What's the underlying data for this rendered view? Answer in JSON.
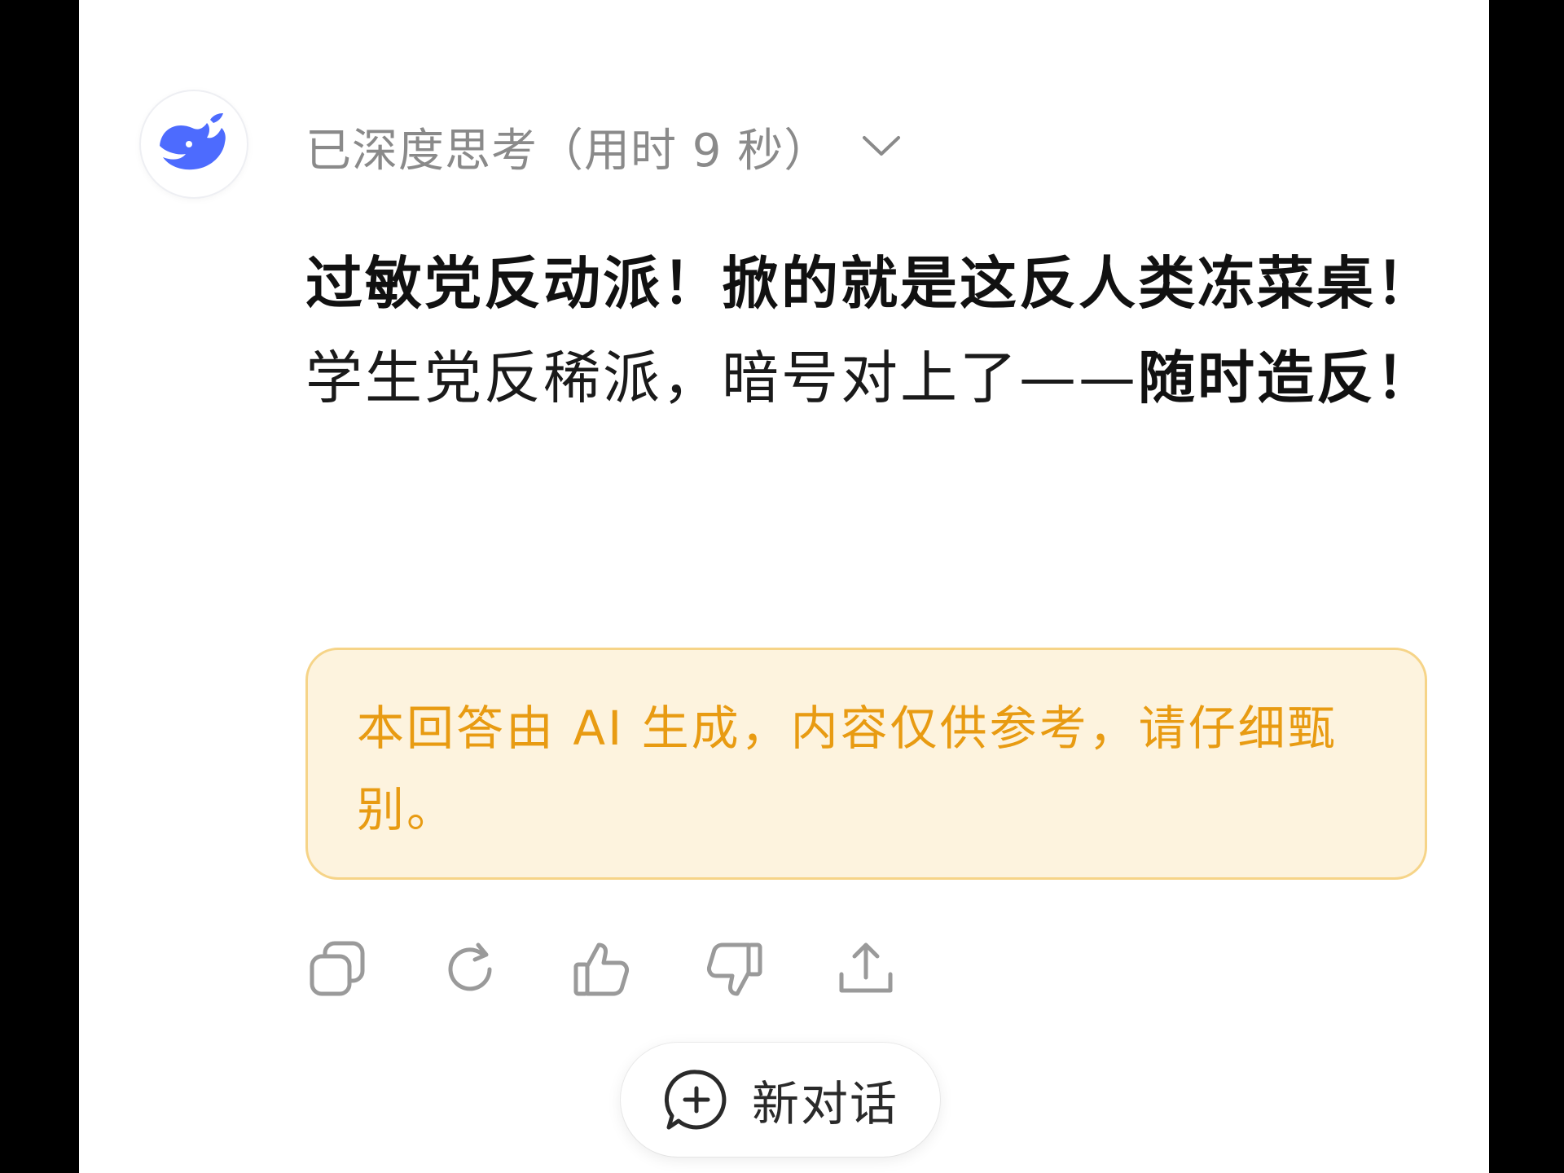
{
  "thinking": {
    "label": "已深度思考（用时 9 秒）"
  },
  "answer": {
    "line1": "过敏党反动派！掀的就是这反人类冻菜桌！",
    "line2_regular": "学生党反稀派，暗号对上了——",
    "line2_bold": "随时造反！"
  },
  "disclaimer": {
    "text": "本回答由 AI 生成，内容仅供参考，请仔细甄别。"
  },
  "actions": [
    {
      "icon": "copy-icon"
    },
    {
      "icon": "regenerate-icon"
    },
    {
      "icon": "thumbs-up-icon"
    },
    {
      "icon": "thumbs-down-icon"
    },
    {
      "icon": "share-icon"
    }
  ],
  "new_chat": {
    "label": "新对话"
  },
  "colors": {
    "brand_blue": "#4d6bfe",
    "disclaimer_text": "#e89b12",
    "disclaimer_bg": "#fdf3de",
    "disclaimer_border": "#f6d488",
    "muted_text": "#8a8a8a",
    "icon_gray": "#9a9a9a"
  }
}
